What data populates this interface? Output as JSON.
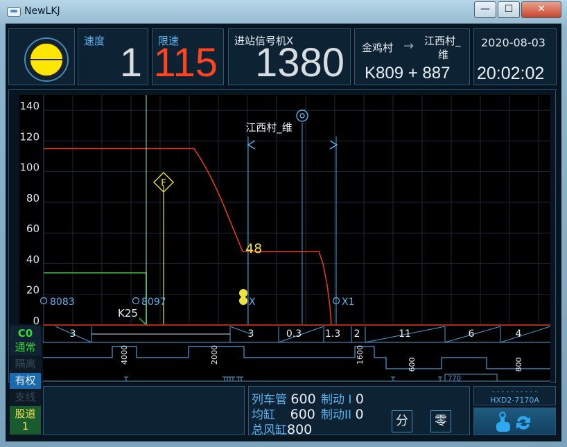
{
  "window": {
    "title": "NewLKJ",
    "minimize": "—",
    "maximize": "☐",
    "close": "✕"
  },
  "header": {
    "speed": {
      "label": "速度",
      "value": "1"
    },
    "limit": {
      "label": "限速",
      "value": "115"
    },
    "signal_dist": {
      "label": "进站信号机X",
      "value": "1380"
    },
    "station": {
      "from": "金鸡村",
      "arrow": "→",
      "to_line1": "江西村_",
      "to_line2": "维",
      "km": "K809 + 887"
    },
    "clock": {
      "date": "2020-08-03",
      "time": "20:02:02"
    },
    "signal_icon": "yellow-signal-lamp-icon"
  },
  "chart_data": {
    "type": "line",
    "title": "",
    "xlabel": "",
    "ylabel": "",
    "ylim": [
      0,
      150
    ],
    "yticks": [
      0,
      20,
      40,
      60,
      80,
      100,
      120,
      140
    ],
    "station_label": "江西村_维",
    "speed_limit_label": "48",
    "markers": [
      {
        "label": "8083"
      },
      {
        "label": "8097"
      },
      {
        "label": "K25"
      },
      {
        "label": "X"
      },
      {
        "label": "X1"
      },
      {
        "label": "F"
      }
    ],
    "series": [],
    "colors": {
      "limit": "#e03a1e",
      "current": "#33cc33",
      "marker": "#5ab4f0",
      "track": "#5ab4f0",
      "yellow": "#f0e040"
    }
  },
  "track": {
    "gradients": [
      "3",
      "3",
      "0.3",
      "1.3",
      "2",
      "11",
      "6",
      "4"
    ],
    "curves": [
      "4000",
      "2000",
      "1600",
      "600",
      "800"
    ],
    "tunnel_label": "770"
  },
  "side": {
    "c0": "C0",
    "normal": "通常",
    "isolate": "隔离",
    "authorized": "有权",
    "branch": "支线",
    "track_label": "股道",
    "track_no": "1"
  },
  "pressure": {
    "train_pipe": {
      "label": "列车管",
      "value": "600"
    },
    "equal_res": {
      "label": "均缸",
      "value": "600"
    },
    "main_res": {
      "label": "总风缸",
      "value": "800"
    },
    "brake1": {
      "label": "制动 I",
      "value": "0"
    },
    "brake2": {
      "label": "制动II",
      "value": "0"
    },
    "fen": "分",
    "ling": "零"
  },
  "footer": {
    "dash": "- - - - - - - - - -",
    "model": "HXD2-7170A",
    "touch_icon": "touch-refresh-icon"
  }
}
